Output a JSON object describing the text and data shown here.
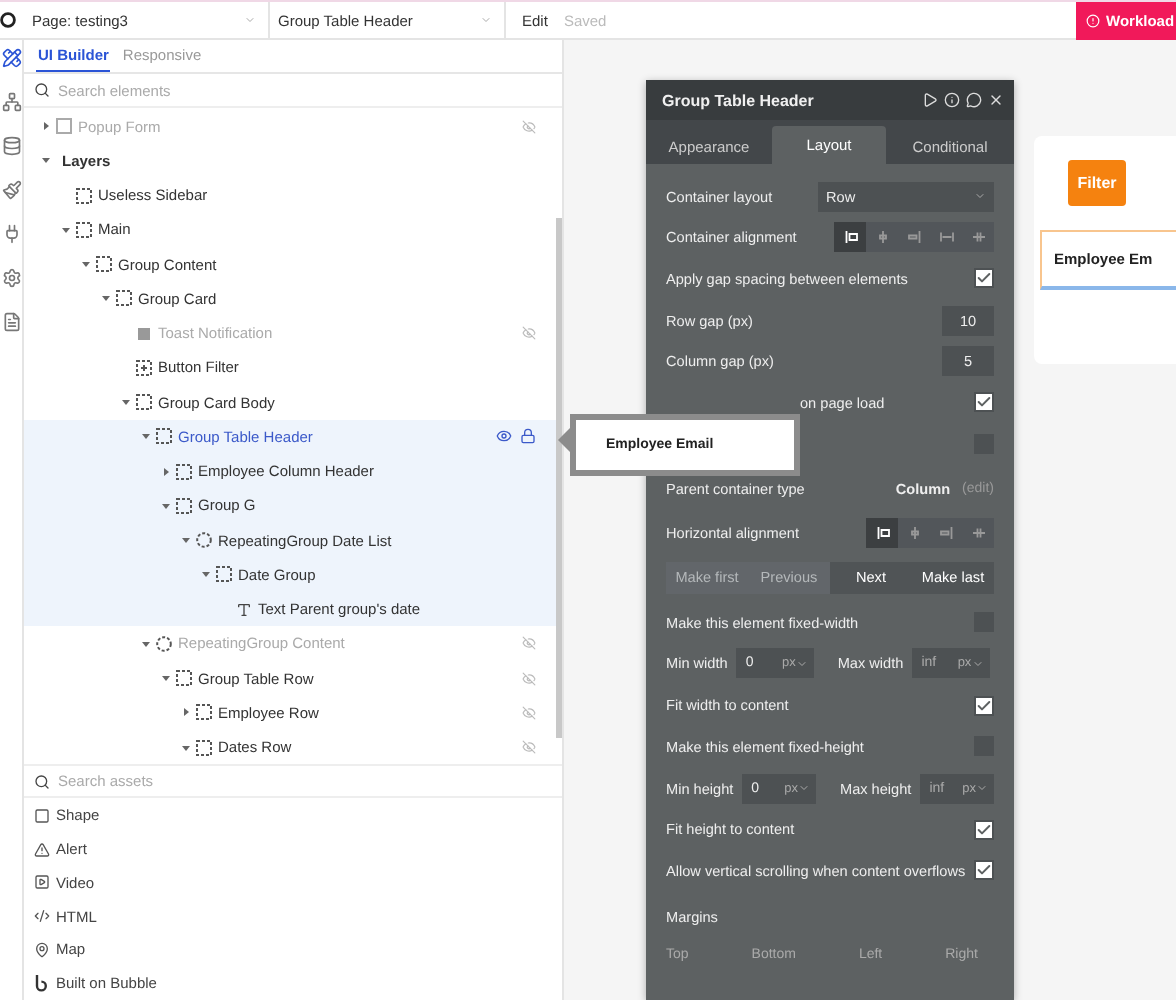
{
  "top_bar": {
    "page_select": "Page: testing3",
    "element_select": "Group Table Header",
    "edit": "Edit",
    "status": "Saved",
    "alert_button": "Workload"
  },
  "rail": [
    {
      "kind": "design",
      "selected": true
    },
    {
      "kind": "workflow",
      "selected": false
    },
    {
      "kind": "data",
      "selected": false
    },
    {
      "kind": "styles",
      "selected": false
    },
    {
      "kind": "plugins",
      "selected": false
    },
    {
      "kind": "settings",
      "selected": false
    },
    {
      "kind": "logs",
      "selected": false
    }
  ],
  "sidebar": {
    "tabs": [
      {
        "label": "UI Builder",
        "selected": true
      },
      {
        "label": "Responsive",
        "selected": false
      }
    ],
    "search": {
      "placeholder": "Search elements"
    },
    "tree": [
      {
        "label": "Popup Form",
        "kind": "popup",
        "selected": false,
        "dimmed": true,
        "hidden": true,
        "expanded": false
      },
      {
        "label": "Layers",
        "kind": "section",
        "selected": false,
        "dimmed": false,
        "hidden": false,
        "expanded": true,
        "children": [
          {
            "label": "Useless Sidebar",
            "kind": "group",
            "selected": false,
            "dimmed": false,
            "hidden": false
          },
          {
            "label": "Main",
            "kind": "group",
            "selected": false,
            "dimmed": false,
            "hidden": false,
            "expanded": true,
            "children": [
              {
                "label": "Group Content",
                "kind": "group",
                "selected": false,
                "dimmed": false,
                "hidden": false,
                "expanded": true,
                "children": [
                  {
                    "label": "Group Card",
                    "kind": "group",
                    "selected": false,
                    "dimmed": false,
                    "hidden": false,
                    "expanded": true,
                    "children": [
                      {
                        "label": "Toast Notification",
                        "kind": "element",
                        "selected": false,
                        "dimmed": true,
                        "hidden": true
                      },
                      {
                        "label": "Button Filter",
                        "kind": "button",
                        "selected": false,
                        "dimmed": false,
                        "hidden": false
                      },
                      {
                        "label": "Group Card Body",
                        "kind": "group",
                        "selected": false,
                        "dimmed": false,
                        "hidden": false,
                        "expanded": true,
                        "children": [
                          {
                            "label": "Group Table Header",
                            "kind": "group",
                            "selected": true,
                            "dimmed": false,
                            "hidden": false,
                            "expanded": true,
                            "children": [
                              {
                                "label": "Employee Column Header",
                                "kind": "group",
                                "selected": false,
                                "dimmed": false,
                                "hidden": false,
                                "expanded": false
                              },
                              {
                                "label": "Group G",
                                "kind": "group",
                                "selected": false,
                                "dimmed": false,
                                "hidden": false,
                                "expanded": true,
                                "children": [
                                  {
                                    "label": "RepeatingGroup Date List",
                                    "kind": "repeating",
                                    "selected": false,
                                    "dimmed": false,
                                    "hidden": false,
                                    "expanded": true,
                                    "children": [
                                      {
                                        "label": "Date Group",
                                        "kind": "group",
                                        "selected": false,
                                        "dimmed": false,
                                        "hidden": false,
                                        "expanded": true,
                                        "children": [
                                          {
                                            "label": "Text Parent group's date",
                                            "kind": "text",
                                            "selected": false,
                                            "dimmed": false,
                                            "hidden": false
                                          }
                                        ]
                                      }
                                    ]
                                  }
                                ]
                              }
                            ]
                          },
                          {
                            "label": "RepeatingGroup Content",
                            "kind": "repeating",
                            "selected": false,
                            "dimmed": true,
                            "hidden": true,
                            "expanded": true,
                            "children": [
                              {
                                "label": "Group Table Row",
                                "kind": "group",
                                "selected": false,
                                "dimmed": false,
                                "hidden": true,
                                "expanded": true,
                                "children": [
                                  {
                                    "label": "Employee Row",
                                    "kind": "group",
                                    "selected": false,
                                    "dimmed": false,
                                    "hidden": true,
                                    "expanded": false
                                  },
                                  {
                                    "label": "Dates Row",
                                    "kind": "group",
                                    "selected": false,
                                    "dimmed": false,
                                    "hidden": true,
                                    "expanded": true
                                  }
                                ]
                              }
                            ]
                          }
                        ]
                      }
                    ]
                  }
                ]
              }
            ]
          }
        ]
      }
    ],
    "asset_search": {
      "placeholder": "Search assets"
    },
    "assets": [
      {
        "label": "Shape",
        "kind": "shape"
      },
      {
        "label": "Alert",
        "kind": "alert"
      },
      {
        "label": "Video",
        "kind": "video"
      },
      {
        "label": "HTML",
        "kind": "html"
      },
      {
        "label": "Map",
        "kind": "map"
      },
      {
        "label": "Built on Bubble",
        "kind": "brand"
      }
    ]
  },
  "property_panel": {
    "title": "Group Table Header",
    "tabs": [
      {
        "label": "Appearance",
        "selected": false
      },
      {
        "label": "Layout",
        "selected": true
      },
      {
        "label": "Conditional",
        "selected": false
      }
    ],
    "rows": [
      {
        "kind": "select",
        "label": "Container layout",
        "value": "Row"
      },
      {
        "kind": "align",
        "label": "Container alignment",
        "options": [
          {
            "kind": "left",
            "selected": true
          },
          {
            "kind": "center",
            "selected": false
          },
          {
            "kind": "right",
            "selected": false
          },
          {
            "kind": "spread",
            "selected": false
          },
          {
            "kind": "middle",
            "selected": false
          }
        ]
      },
      {
        "kind": "check",
        "label": "Apply gap spacing between elements",
        "checked": true
      },
      {
        "kind": "number",
        "label": "Row gap (px)",
        "value": "10"
      },
      {
        "kind": "number",
        "label": "Column gap (px)",
        "value": "5"
      },
      {
        "kind": "covered_check",
        "label": "on page load",
        "checked": true
      },
      {
        "kind": "covered_check",
        "checked": false
      },
      {
        "kind": "info",
        "label": "Parent container type",
        "value": "Column",
        "link": "(edit)"
      },
      {
        "kind": "align",
        "label": "Horizontal alignment",
        "options": [
          {
            "kind": "left",
            "selected": true
          },
          {
            "kind": "center",
            "selected": false
          },
          {
            "kind": "right",
            "selected": false
          },
          {
            "kind": "middle",
            "selected": false
          }
        ]
      },
      {
        "kind": "buttons",
        "buttons": [
          {
            "label": "Make first",
            "disabled": true
          },
          {
            "label": "Previous",
            "disabled": true
          },
          {
            "label": "Next",
            "disabled": false
          },
          {
            "label": "Make last",
            "disabled": false
          }
        ]
      },
      {
        "kind": "check",
        "label": "Make this element fixed-width",
        "checked": false
      },
      {
        "kind": "range",
        "min_label": "Min width",
        "min_value": "0",
        "min_unit": "px",
        "max_label": "Max width",
        "max_placeholder": "inf",
        "max_unit": "px"
      },
      {
        "kind": "check",
        "label": "Fit width to content",
        "checked": true
      },
      {
        "kind": "check",
        "label": "Make this element fixed-height",
        "checked": false
      },
      {
        "kind": "range",
        "min_label": "Min height",
        "min_value": "0",
        "min_unit": "px",
        "max_label": "Max height",
        "max_placeholder": "inf",
        "max_unit": "px"
      },
      {
        "kind": "check",
        "label": "Fit height to content",
        "checked": true
      },
      {
        "kind": "check",
        "label": "Allow vertical scrolling when content overflows",
        "checked": true
      },
      {
        "kind": "section",
        "label": "Margins"
      },
      {
        "kind": "columns",
        "labels": [
          "Top",
          "Bottom",
          "Left",
          "Right"
        ]
      }
    ]
  },
  "canvas": {
    "filter_button": "Filter",
    "header_cell": "Employee Em",
    "preview": "Employee Email"
  }
}
